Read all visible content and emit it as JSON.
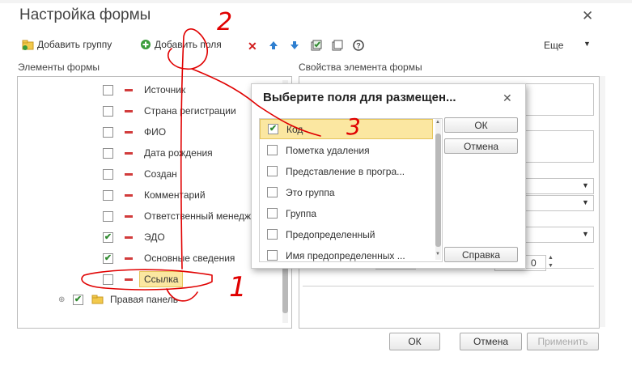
{
  "dialog": {
    "title": "Настройка формы"
  },
  "toolbar": {
    "add_group": "Добавить группу",
    "add_fields": "Добавить поля",
    "more": "Еще"
  },
  "left": {
    "title": "Элементы формы",
    "items": [
      {
        "label": "Источник",
        "checked": false
      },
      {
        "label": "Страна регистрации",
        "checked": false
      },
      {
        "label": "ФИО",
        "checked": false
      },
      {
        "label": "Дата рождения",
        "checked": false
      },
      {
        "label": "Создан",
        "checked": false
      },
      {
        "label": "Комментарий",
        "checked": false
      },
      {
        "label": "Ответственный менедж",
        "checked": false
      },
      {
        "label": "ЭДО",
        "checked": true
      },
      {
        "label": "Основные сведения",
        "checked": true
      },
      {
        "label": "Ссылка",
        "checked": false
      }
    ],
    "group": {
      "label": "Правая панель",
      "checked": true
    }
  },
  "right": {
    "title": "Свойства элемента формы",
    "number": "0"
  },
  "popup": {
    "title": "Выберите поля для размещен...",
    "items": [
      {
        "label": "Код",
        "checked": true
      },
      {
        "label": "Пометка удаления",
        "checked": false
      },
      {
        "label": "Представление в програ...",
        "checked": false
      },
      {
        "label": "Это группа",
        "checked": false
      },
      {
        "label": "Группа",
        "checked": false
      },
      {
        "label": "Предопределенный",
        "checked": false
      },
      {
        "label": "Имя предопределенных ...",
        "checked": false
      }
    ],
    "ok": "ОК",
    "cancel": "Отмена",
    "help": "Справка"
  },
  "footer": {
    "ok": "ОК",
    "cancel": "Отмена",
    "apply": "Применить"
  },
  "annotations": {
    "one": "1",
    "two": "2",
    "three": "3"
  },
  "colors": {
    "selection": "#fbe7a1",
    "check": "#2f8a2f",
    "remove": "#d23c3c",
    "ink": "#e00000"
  }
}
